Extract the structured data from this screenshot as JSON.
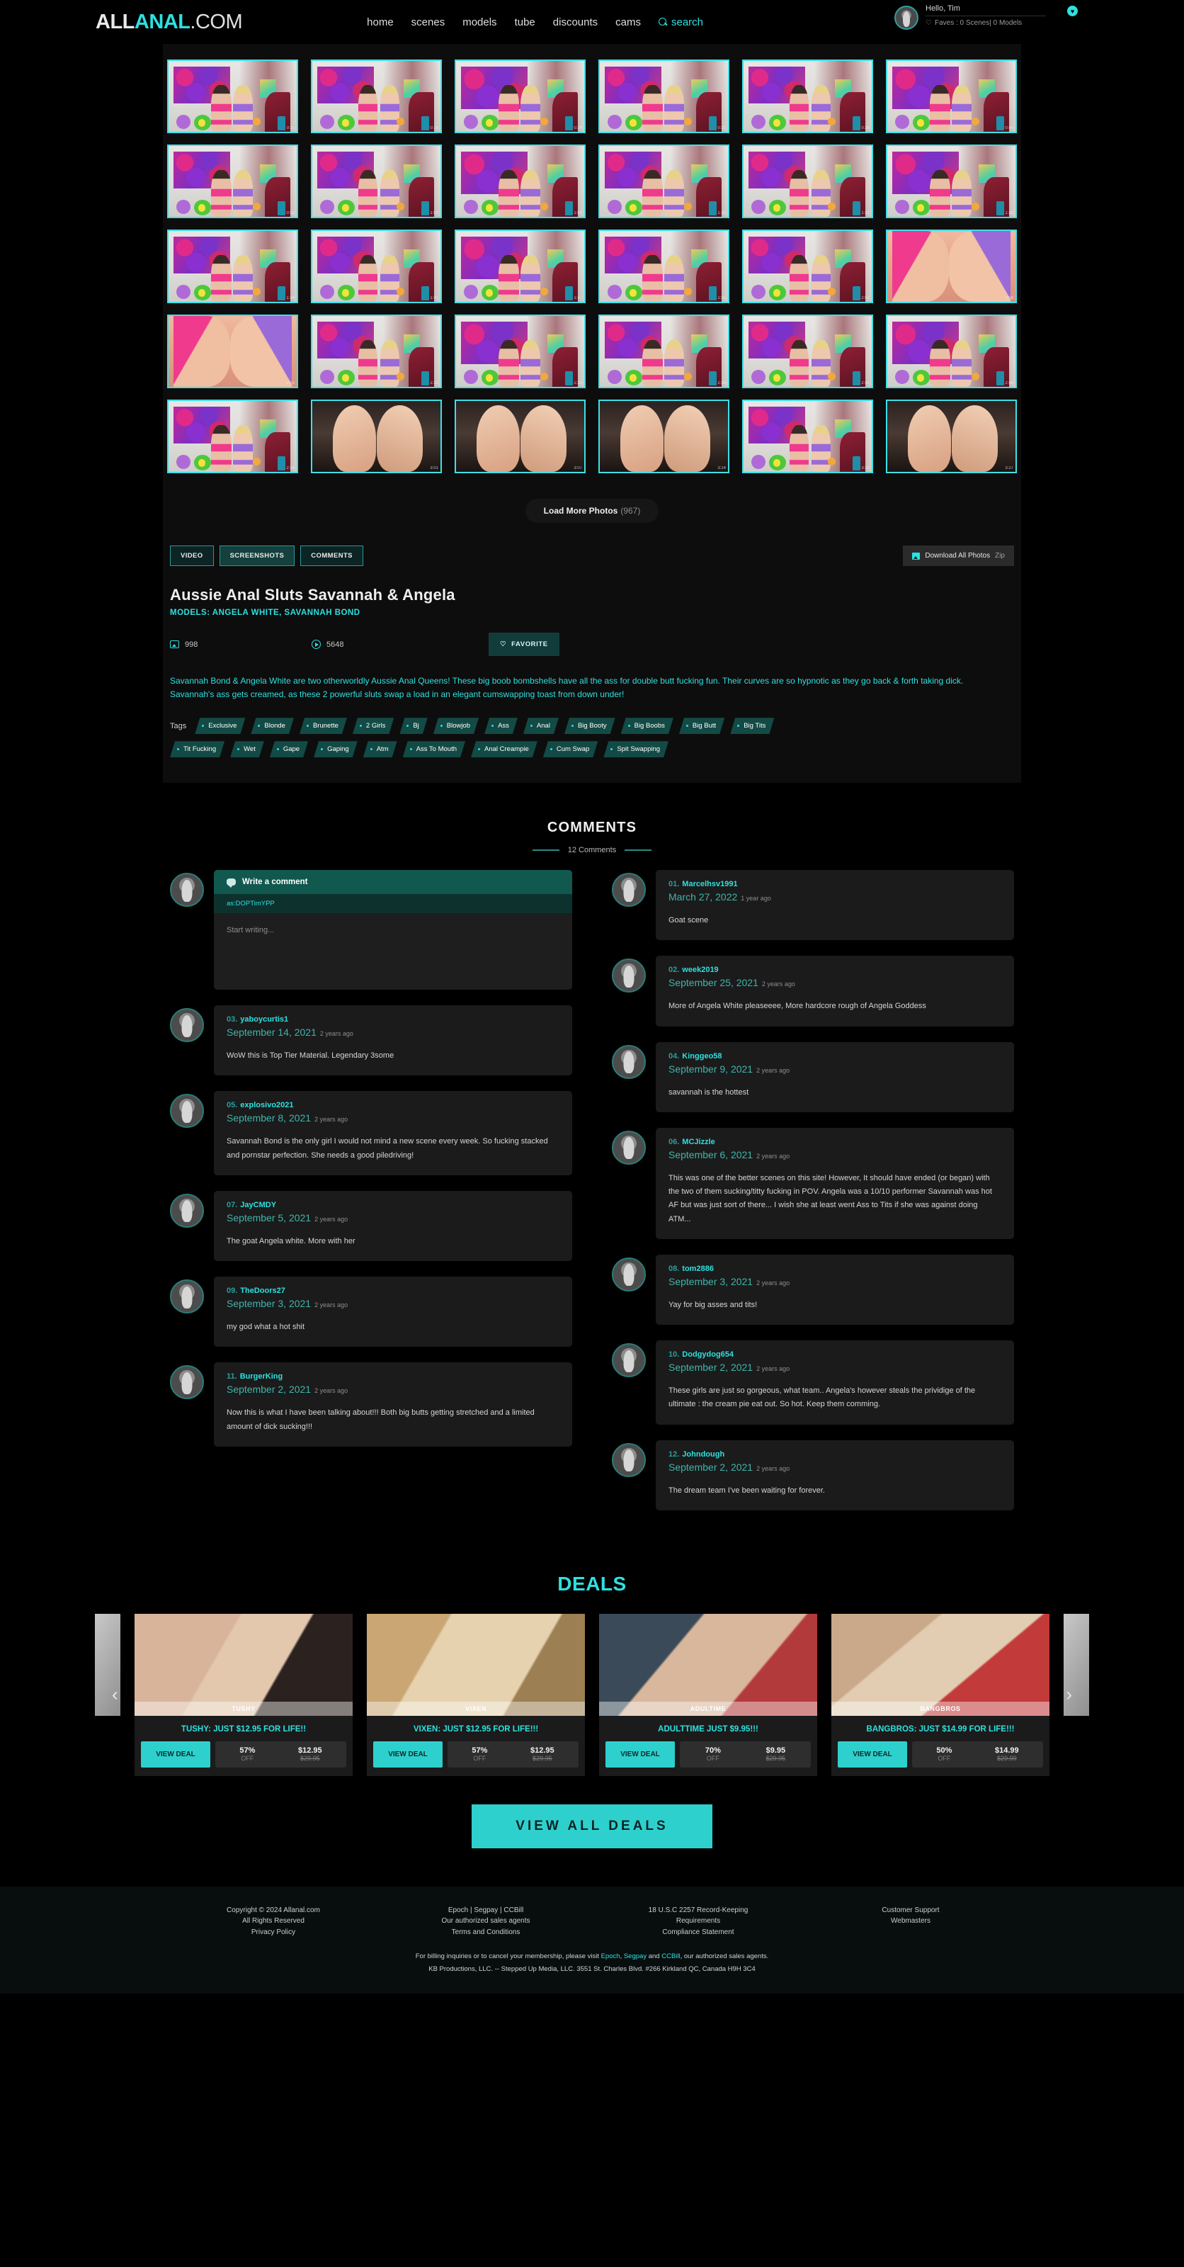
{
  "header": {
    "logo": {
      "part1": "ALL",
      "part2": "ANAL",
      "part3": ".COM"
    },
    "nav": [
      {
        "label": "home"
      },
      {
        "label": "scenes"
      },
      {
        "label": "models"
      },
      {
        "label": "tube"
      },
      {
        "label": "discounts"
      },
      {
        "label": "cams"
      }
    ],
    "search_label": "search",
    "user": {
      "greeting": "Hello, Tim",
      "faves": "Faves : 0 Scenes| 0 Models",
      "caret": "♥"
    }
  },
  "gallery": {
    "thumb_count": 30,
    "load_more_label": "Load More Photos",
    "load_more_count": "(967)",
    "thumb_durations": [
      "0:11",
      "0:18",
      "0:24",
      "0:31",
      "0:38",
      "0:45",
      "0:52",
      "1:02",
      "1:09",
      "1:15",
      "1:21",
      "1:28",
      "1:34",
      "1:41",
      "1:47",
      "1:55",
      "2:02",
      "2:08",
      "2:15",
      "2:22",
      "2:28",
      "2:35",
      "2:41",
      "2:48",
      "2:54",
      "3:01",
      "3:07",
      "3:14",
      "3:20",
      "3:27"
    ]
  },
  "tabs": [
    {
      "label": "VIDEO",
      "active": false
    },
    {
      "label": "SCREENSHOTS",
      "active": true
    },
    {
      "label": "COMMENTS",
      "active": false
    }
  ],
  "download": {
    "label": "Download All Photos",
    "format": "Zip"
  },
  "scene": {
    "title": "Aussie Anal Sluts Savannah & Angela",
    "models_line": "MODELS: ANGELA WHITE, SAVANNAH BOND",
    "photo_count": "998",
    "view_count": "5648",
    "favorite_label": "FAVORITE",
    "description": "Savannah Bond & Angela White are two otherworldly Aussie Anal Queens! These big boob bombshells have all the ass for double butt fucking fun. Their curves are so hypnotic as they go back & forth taking dick. Savannah's ass gets creamed, as these 2 powerful sluts swap a load in an elegant cumswapping toast from down under!",
    "tags_label": "Tags",
    "tags_row1": [
      "Exclusive",
      "Blonde",
      "Brunette",
      "2 Girls",
      "Bj",
      "Blowjob",
      "Ass",
      "Anal",
      "Big Booty",
      "Big Boobs",
      "Big Butt",
      "Big Tits"
    ],
    "tags_row2": [
      "Tit Fucking",
      "Wet",
      "Gape",
      "Gaping",
      "Atm",
      "Ass To Mouth",
      "Anal Creampie",
      "Cum Swap",
      "Spit Swapping"
    ]
  },
  "comments": {
    "heading": "COMMENTS",
    "count_label": "12 Comments",
    "write": {
      "header": "Write a comment",
      "as_label": "as:DOPTimYPP",
      "placeholder": "Start writing..."
    },
    "left": [
      {
        "num": "03.",
        "user": "yaboycurtis1",
        "date": "September 14, 2021",
        "ago": "2 years ago",
        "text": "WoW this is Top Tier Material. Legendary 3some"
      },
      {
        "num": "05.",
        "user": "explosivo2021",
        "date": "September 8, 2021",
        "ago": "2 years ago",
        "text": "Savannah Bond is the only girl I would not mind a new scene every week. So fucking stacked and pornstar perfection. She needs a good piledriving!"
      },
      {
        "num": "07.",
        "user": "JayCMDY",
        "date": "September 5, 2021",
        "ago": "2 years ago",
        "text": "The goat Angela white. More with her"
      },
      {
        "num": "09.",
        "user": "TheDoors27",
        "date": "September 3, 2021",
        "ago": "2 years ago",
        "text": "my god what a hot shit"
      },
      {
        "num": "11.",
        "user": "BurgerKing",
        "date": "September 2, 2021",
        "ago": "2 years ago",
        "text": "Now this is what I have been talking about!!! Both big butts getting stretched and a limited amount of dick sucking!!!"
      }
    ],
    "right": [
      {
        "num": "01.",
        "user": "Marcelhsv1991",
        "date": "March 27, 2022",
        "ago": "1 year ago",
        "text": "Goat scene"
      },
      {
        "num": "02.",
        "user": "week2019",
        "date": "September 25, 2021",
        "ago": "2 years ago",
        "text": "More of Angela White pleaseeee, More hardcore rough of Angela Goddess"
      },
      {
        "num": "04.",
        "user": "Kinggeo58",
        "date": "September 9, 2021",
        "ago": "2 years ago",
        "text": "savannah is the hottest"
      },
      {
        "num": "06.",
        "user": "MCJizzle",
        "date": "September 6, 2021",
        "ago": "2 years ago",
        "text": "This was one of the better scenes on this site! However, It should have ended (or began) with the two of them sucking/titty fucking in POV. Angela was a 10/10 performer Savannah was hot AF but was just sort of there... I wish she at least went Ass to Tits if she was against doing ATM..."
      },
      {
        "num": "08.",
        "user": "tom2886",
        "date": "September 3, 2021",
        "ago": "2 years ago",
        "text": "Yay for big asses and tits!"
      },
      {
        "num": "10.",
        "user": "Dodgydog654",
        "date": "September 2, 2021",
        "ago": "2 years ago",
        "text": "These girls are just so gorgeous, what team.. Angela's however steals the prividige of the ultimate : the cream pie eat out. So hot. Keep them comming."
      },
      {
        "num": "12.",
        "user": "Johndough",
        "date": "September 2, 2021",
        "ago": "2 years ago",
        "text": "The dream team I've been waiting for forever."
      }
    ]
  },
  "deals": {
    "heading": "DEALS",
    "view_all_label": "VIEW ALL DEALS",
    "arrow_left": "‹",
    "arrow_right": "›",
    "items": [
      {
        "brand": "TUSHY",
        "headline": "TUSHY: JUST $12.95 FOR LIFE!!",
        "button": "VIEW DEAL",
        "percent": "57%",
        "off_label": "OFF",
        "price": "$12.95",
        "old_price": "$29.95",
        "img_class": "img-tushy"
      },
      {
        "brand": "VIXEN",
        "headline": "VIXEN: JUST $12.95 FOR LIFE!!!",
        "button": "VIEW DEAL",
        "percent": "57%",
        "off_label": "OFF",
        "price": "$12.95",
        "old_price": "$29.95",
        "img_class": "img-vixen"
      },
      {
        "brand": "ADULTIME",
        "headline": "ADULTTIME JUST $9.95!!!",
        "button": "VIEW DEAL",
        "percent": "70%",
        "off_label": "OFF",
        "price": "$9.95",
        "old_price": "$29.95",
        "img_class": "img-adult"
      },
      {
        "brand": "BANGBROS",
        "headline": "BANGBROS: JUST $14.99 FOR LIFE!!!",
        "button": "VIEW DEAL",
        "percent": "50%",
        "off_label": "OFF",
        "price": "$14.99",
        "old_price": "$29.99",
        "img_class": "img-bang"
      }
    ]
  },
  "footer": {
    "col1": [
      "Copyright © 2024 Allanal.com",
      "All Rights Reserved",
      "Privacy Policy"
    ],
    "col2": [
      "Epoch | Segpay | CCBill",
      "Our authorized sales agents",
      "Terms and Conditions"
    ],
    "col3": [
      "18 U.S.C 2257 Record-Keeping",
      "Requirements",
      "Compliance Statement"
    ],
    "col4": [
      "Customer Support",
      "Webmasters"
    ],
    "billing_prefix": "For billing inquiries or to cancel your membership, please visit ",
    "billing_epoch": "Epoch",
    "billing_sep1": ", ",
    "billing_segpay": "Segpay",
    "billing_and": " and ",
    "billing_ccbill": "CCBill",
    "billing_suffix": ", our authorized sales agents.",
    "address": "KB Productions, LLC. -- Stepped Up Media, LLC. 3551 St. Charles Blvd. #266 Kirkland QC, Canada H9H 3C4"
  }
}
